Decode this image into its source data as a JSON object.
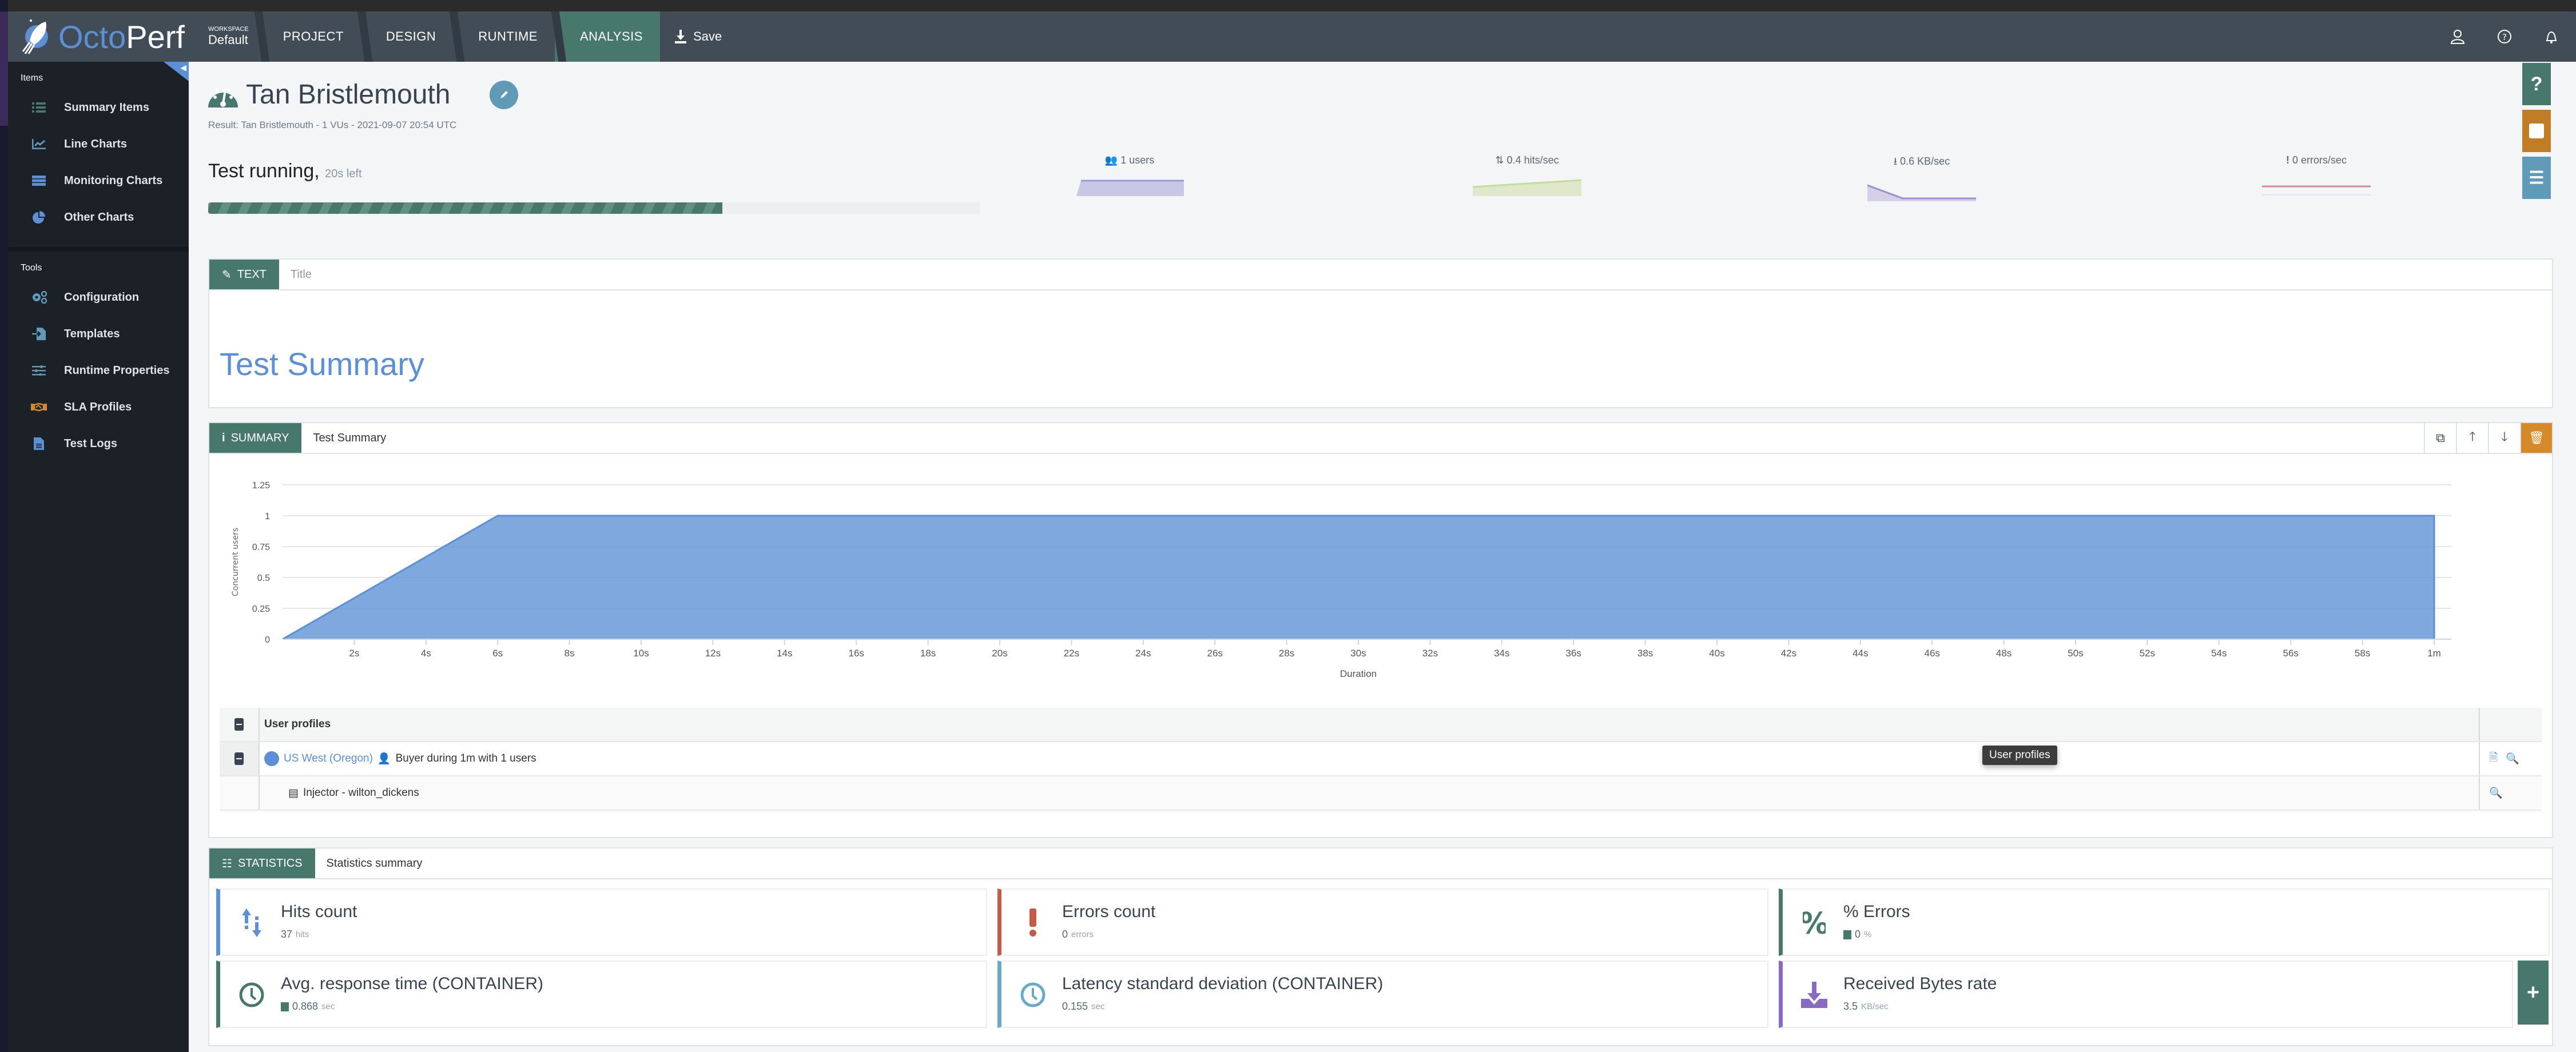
{
  "app": {
    "brand_left": "Octo",
    "brand_right": "Perf"
  },
  "navbar": {
    "workspace_label": "WORKSPACE",
    "workspace_value": "Default",
    "crumbs": [
      {
        "label": "PROJECT",
        "active": false
      },
      {
        "label": "DESIGN",
        "active": false
      },
      {
        "label": "RUNTIME",
        "active": false
      },
      {
        "label": "ANALYSIS",
        "active": true
      }
    ],
    "save_label": "Save",
    "icons": [
      "user-icon",
      "help-icon",
      "bell-icon"
    ]
  },
  "sidebar": {
    "items_title": "Items",
    "items": [
      {
        "label": "Summary Items",
        "icon": "list-icon",
        "color": "#47786b"
      },
      {
        "label": "Line Charts",
        "icon": "line-chart-icon",
        "color": "#5f9bb9"
      },
      {
        "label": "Monitoring Charts",
        "icon": "server-icon",
        "color": "#5b8fd6"
      },
      {
        "label": "Other Charts",
        "icon": "pie-chart-icon",
        "color": "#5b8fd6"
      }
    ],
    "tools_title": "Tools",
    "tools": [
      {
        "label": "Configuration",
        "icon": "cogs-icon",
        "color": "#5f9bb9"
      },
      {
        "label": "Templates",
        "icon": "file-import-icon",
        "color": "#5f9bb9"
      },
      {
        "label": "Runtime Properties",
        "icon": "sliders-icon",
        "color": "#5f9bb9"
      },
      {
        "label": "SLA Profiles",
        "icon": "handshake-icon",
        "color": "#d58a2a"
      },
      {
        "label": "Test Logs",
        "icon": "file-text-icon",
        "color": "#5b8fd6"
      }
    ]
  },
  "right_tabs": [
    {
      "name": "help-tab",
      "icon": "?",
      "color": "#47786b"
    },
    {
      "name": "stop-tab",
      "icon": "■",
      "color": "#c07d26"
    },
    {
      "name": "list-tab",
      "icon": "☰",
      "color": "#5f9bb9"
    }
  ],
  "header": {
    "title": "Tan Bristlemouth",
    "subtitle": "Result: Tan Bristlemouth - 1 VUs - 2021-09-07 20:54 UTC",
    "status": "Test running,",
    "time_left": "20s left",
    "progress_percent": 66.6
  },
  "live_stats": [
    {
      "icon": "users-icon",
      "value": "1",
      "unit": "users",
      "color": "#9a9ad6"
    },
    {
      "icon": "hits-icon",
      "value": "0.4",
      "unit": "hits/sec",
      "color": "#c5dc9a"
    },
    {
      "icon": "download-icon",
      "value": "0.6",
      "unit": "KB/sec",
      "color": "#9a8fd6"
    },
    {
      "icon": "exclamation-icon",
      "value": "0",
      "unit": "errors/sec",
      "color": "#d6889a"
    }
  ],
  "text_panel": {
    "tag": "TEXT",
    "title_placeholder": "Title",
    "content": "Test Summary"
  },
  "summary_panel": {
    "tag": "SUMMARY",
    "title": "Test Summary",
    "tools": [
      "copy-icon",
      "arrow-up-icon",
      "arrow-down-icon",
      "trash-icon"
    ]
  },
  "chart_data": {
    "type": "area",
    "title": "",
    "xlabel": "Duration",
    "ylabel": "Concurrent users",
    "x": [
      0,
      6,
      60
    ],
    "series": [
      {
        "name": "Concurrent users",
        "values": [
          0,
          1,
          1
        ],
        "color": "#5b8fd6"
      }
    ],
    "xlim": [
      0,
      60
    ],
    "ylim": [
      0,
      1.25
    ],
    "xticks": [
      "2s",
      "4s",
      "6s",
      "8s",
      "10s",
      "12s",
      "14s",
      "16s",
      "18s",
      "20s",
      "22s",
      "24s",
      "26s",
      "28s",
      "30s",
      "32s",
      "34s",
      "36s",
      "38s",
      "40s",
      "42s",
      "44s",
      "46s",
      "48s",
      "50s",
      "52s",
      "54s",
      "56s",
      "58s",
      "1m"
    ],
    "yticks": [
      "0",
      "0.25",
      "0.5",
      "0.75",
      "1",
      "1.25"
    ],
    "grid": true
  },
  "user_profiles": {
    "header": "User profiles",
    "rows": [
      {
        "location": "US West (Oregon)",
        "text": "Buyer during 1m  with 1 users"
      },
      {
        "text": "Injector - wilton_dickens"
      }
    ],
    "tooltip": "User profiles"
  },
  "statistics_panel": {
    "tag": "STATISTICS",
    "title": "Statistics summary",
    "cards": [
      {
        "name": "Hits count",
        "value": "37",
        "unit": "hits",
        "color": "#5b8fd6",
        "icon": "hits-icon",
        "square": false
      },
      {
        "name": "Errors count",
        "value": "0",
        "unit": "errors",
        "color": "#c45a48",
        "icon": "exclamation-icon",
        "square": false
      },
      {
        "name": "% Errors",
        "value": "0",
        "unit": "%",
        "color": "#47786b",
        "icon": "percent-icon",
        "square": true
      },
      {
        "name": "Avg. response time (CONTAINER)",
        "value": "0.868",
        "unit": "sec",
        "color": "#47786b",
        "icon": "clock-icon",
        "square": true
      },
      {
        "name": "Latency standard deviation (CONTAINER)",
        "value": "0.155",
        "unit": "sec",
        "color": "#6aaac9",
        "icon": "clock-icon",
        "square": false
      },
      {
        "name": "Received Bytes rate",
        "value": "3.5",
        "unit": "KB/sec",
        "color": "#8a6bc4",
        "icon": "download-icon",
        "square": false
      }
    ]
  }
}
